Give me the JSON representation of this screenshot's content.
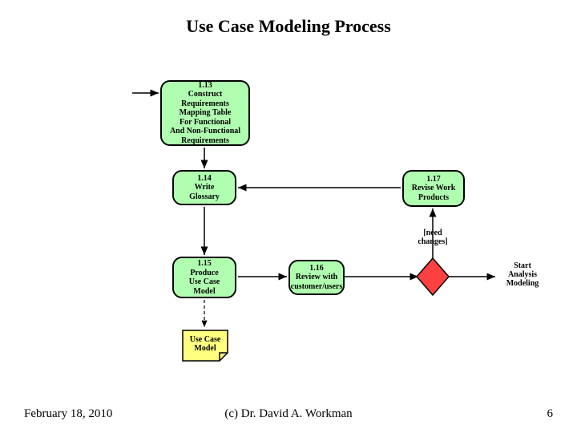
{
  "title": "Use Case Modeling Process",
  "nodes": {
    "n113": {
      "num": "1.13",
      "l1": "Construct Requirements",
      "l2": "Mapping Table",
      "l3": "For Functional",
      "l4": "And Non-Functional",
      "l5": "Requirements"
    },
    "n114": {
      "num": "1.14",
      "l1": "Write",
      "l2": "Glossary"
    },
    "n115": {
      "num": "1.15",
      "l1": "Produce",
      "l2": "Use Case",
      "l3": "Model"
    },
    "n116": {
      "num": "1.16",
      "l1": "Review with",
      "l2": "customer/users"
    },
    "n117": {
      "num": "1.17",
      "l1": "Revise Work",
      "l2": "Products"
    }
  },
  "artifact": {
    "l1": "Use Case",
    "l2": "Model"
  },
  "guards": {
    "need_changes": "[need\nchanges]"
  },
  "end_label": "Start\nAnalysis\nModeling",
  "footer": {
    "date": "February 18, 2010",
    "center": "(c) Dr. David A. Workman",
    "page": "6"
  }
}
